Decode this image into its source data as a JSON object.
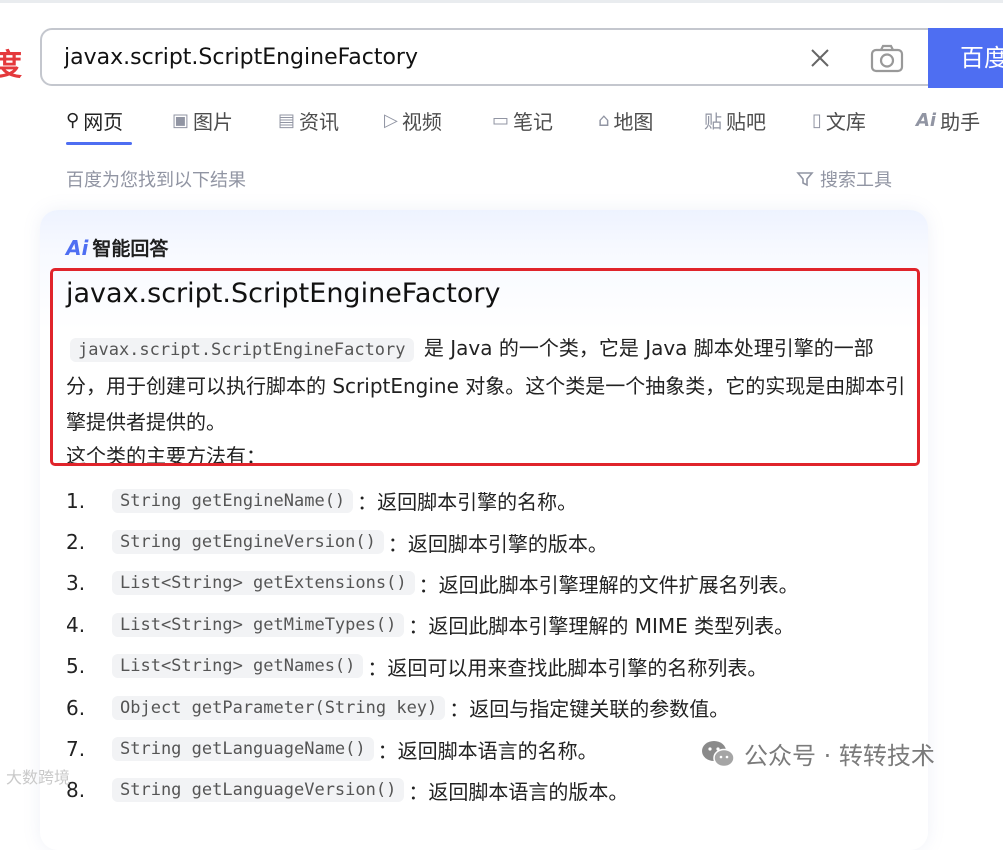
{
  "logo_fragment": "度",
  "search": {
    "query": "javax.script.ScriptEngineFactory",
    "button_label": "百度"
  },
  "tabs": [
    {
      "label": "网页",
      "icon": "search-icon"
    },
    {
      "label": "图片",
      "icon": "image-icon"
    },
    {
      "label": "资讯",
      "icon": "news-icon"
    },
    {
      "label": "视频",
      "icon": "video-icon"
    },
    {
      "label": "笔记",
      "icon": "note-icon"
    },
    {
      "label": "地图",
      "icon": "map-icon"
    },
    {
      "label": "贴吧",
      "icon": "tieba-icon"
    },
    {
      "label": "文库",
      "icon": "doc-icon"
    },
    {
      "label": "助手",
      "icon": "ai-icon"
    }
  ],
  "results_hint": "百度为您找到以下结果",
  "search_tools_label": "搜索工具",
  "ai_answer": {
    "logo": "Ai",
    "header": "智能回答",
    "title": "javax.script.ScriptEngineFactory",
    "code_ref": "javax.script.ScriptEngineFactory",
    "paragraph_text": "是 Java 的一个类，它是 Java 脚本处理引擎的一部分，用于创建可以执行脚本的 ScriptEngine 对象。这个类是一个抽象类，它的实现是由脚本引擎提供者提供的。",
    "methods_lead": "这个类的主要方法有：",
    "methods": [
      {
        "num": "1.",
        "code": "String getEngineName()",
        "desc": "：返回脚本引擎的名称。"
      },
      {
        "num": "2.",
        "code": "String getEngineVersion()",
        "desc": "：返回脚本引擎的版本。"
      },
      {
        "num": "3.",
        "code": "List<String> getExtensions()",
        "desc": "：返回此脚本引擎理解的文件扩展名列表。"
      },
      {
        "num": "4.",
        "code": "List<String> getMimeTypes()",
        "desc": "：返回此脚本引擎理解的 MIME 类型列表。"
      },
      {
        "num": "5.",
        "code": "List<String> getNames()",
        "desc": "：返回可以用来查找此脚本引擎的名称列表。"
      },
      {
        "num": "6.",
        "code": "Object getParameter(String key)",
        "desc": "：返回与指定键关联的参数值。"
      },
      {
        "num": "7.",
        "code": "String getLanguageName()",
        "desc": "：返回脚本语言的名称。"
      },
      {
        "num": "8.",
        "code": "String getLanguageVersion()",
        "desc": "：返回脚本语言的版本。"
      }
    ]
  },
  "watermark": "公众号 · 转转技术",
  "corner_watermark": "大数跨境",
  "colors": {
    "accent": "#4e6ef2",
    "highlight": "#e0242b"
  }
}
